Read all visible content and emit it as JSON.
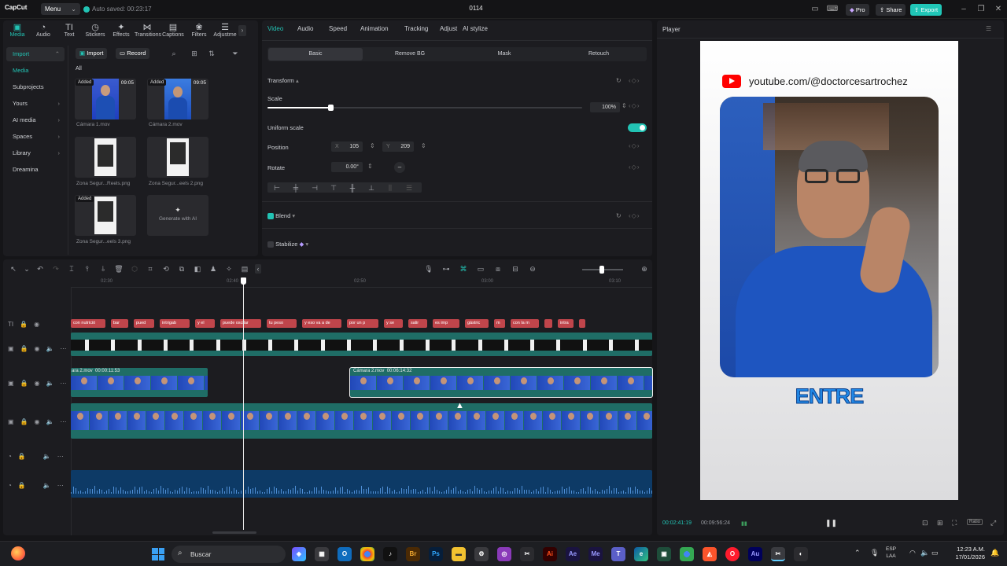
{
  "titlebar": {
    "app_name": "CapCut",
    "menu_label": "Menu",
    "autosave": "Auto saved: 00:23:17",
    "project_name": "0114",
    "pro_label": "Pro",
    "share_label": "Share",
    "export_label": "Export"
  },
  "toolbar": {
    "items": [
      "Media",
      "Audio",
      "Text",
      "Stickers",
      "Effects",
      "Transitions",
      "Captions",
      "Filters",
      "Adjustme"
    ]
  },
  "media": {
    "categories": [
      "Import",
      "Media",
      "Subprojects",
      "Yours",
      "AI media",
      "Spaces",
      "Library",
      "Dreamina"
    ],
    "import_label": "Import",
    "record_label": "Record",
    "all_label": "All",
    "added_label": "Added",
    "generate_label": "Generate with AI",
    "items": [
      {
        "name": "Cámara 1.mov",
        "duration": "09:05"
      },
      {
        "name": "Cámara 2.mov",
        "duration": "09:05"
      },
      {
        "name": "Zona Segur...Reels.png"
      },
      {
        "name": "Zona Segur...eels 2.png"
      },
      {
        "name": "Zona Segur...eels 3.png"
      }
    ]
  },
  "properties": {
    "tabs": [
      "Video",
      "Audio",
      "Speed",
      "Animation",
      "Tracking",
      "Adjust",
      "AI stylize"
    ],
    "subtabs": [
      "Basic",
      "Remove BG",
      "Mask",
      "Retouch"
    ],
    "transform_label": "Transform",
    "scale_label": "Scale",
    "scale_value": "100%",
    "scale_level": 0.2,
    "uniform_scale_label": "Uniform scale",
    "position_label": "Position",
    "pos_x_label": "X",
    "pos_x": "105",
    "pos_y_label": "Y",
    "pos_y": "209",
    "rotate_label": "Rotate",
    "rotate_value": "0.00°",
    "blend_label": "Blend",
    "stabilize_label": "Stabilize"
  },
  "player": {
    "title": "Player",
    "channel": "youtube.com/@doctorcesartrochez",
    "caption_word": "ENTRE",
    "time_current": "00:02:41:19",
    "time_total": "00:09:56:24",
    "ratio_label": "Ratio"
  },
  "timeline": {
    "ruler": [
      "02:30",
      "02:40",
      "02:50",
      "03:00",
      "03:10"
    ],
    "captions": [
      "con nutrició",
      "bar",
      "pued",
      "intrigab",
      "y el",
      "puede oscilar",
      "tu peso",
      "y eso va a de",
      "por un p",
      "y se",
      "salir",
      "es imp",
      "gástric",
      "m",
      "con la m",
      "",
      "intra",
      ""
    ],
    "clip1_name": "ara 2.mov",
    "clip1_time": "00:00:11:53",
    "clip2_name": "Cámara 2.mov",
    "clip2_time": "00:06:14:32"
  },
  "taskbar": {
    "search_placeholder": "Buscar",
    "lang": "ESP",
    "lang2": "LAA",
    "time": "12:23 A.M.",
    "date": "17/01/2026",
    "apps": [
      "Br",
      "Ps",
      "Ai",
      "Ae",
      "Me",
      "Au"
    ]
  }
}
